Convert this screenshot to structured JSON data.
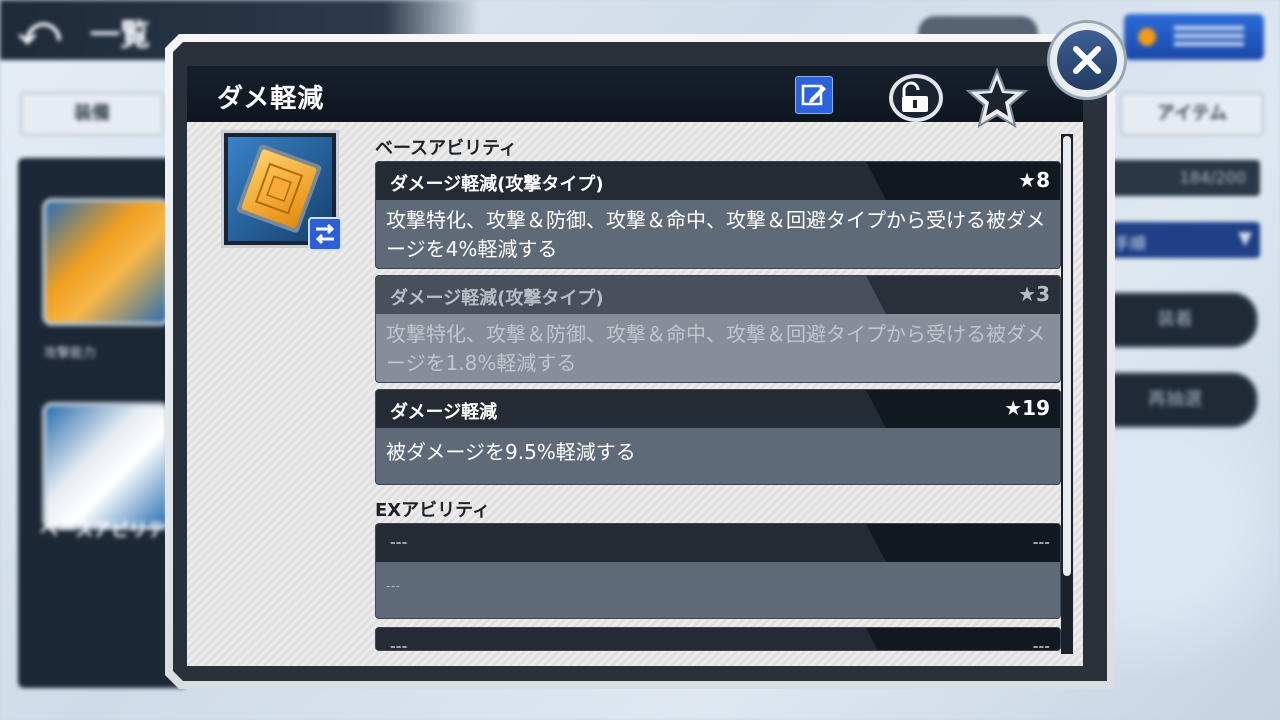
{
  "background": {
    "back_label": "⤺",
    "screen_title": "一覧",
    "tab_left": "装備",
    "tab_right": "アイテム",
    "count": "184/200",
    "sort_label": "入手順",
    "left_chip_label": "攻撃能力",
    "left_section_label": "ベースアビリティ",
    "button_top": "装着",
    "button_bottom": "再抽選"
  },
  "dialog": {
    "title": "ダメ軽減",
    "icons": {
      "edit": "edit-icon",
      "lock": "unlock-icon",
      "favorite": "star-icon",
      "close": "close-icon",
      "swap": "swap-icon"
    },
    "base_section_label": "ベースアビリティ",
    "ex_section_label": "EXアビリティ",
    "base_abilities": [
      {
        "name": "ダメージ軽減(攻撃タイプ)",
        "rank": "★8",
        "description": "攻撃特化、攻撃＆防御、攻撃＆命中、攻撃＆回避タイプから受ける被ダメージを4%軽減する",
        "active": true
      },
      {
        "name": "ダメージ軽減(攻撃タイプ)",
        "rank": "★3",
        "description": "攻撃特化、攻撃＆防御、攻撃＆命中、攻撃＆回避タイプから受ける被ダメージを1.8%軽減する",
        "active": false
      },
      {
        "name": "ダメージ軽減",
        "rank": "★19",
        "description": "被ダメージを9.5%軽減する",
        "active": true
      }
    ],
    "ex_abilities": [
      {
        "name": "---",
        "rank": "---",
        "description": "---"
      },
      {
        "name": "---",
        "rank": "---",
        "description": ""
      }
    ]
  }
}
